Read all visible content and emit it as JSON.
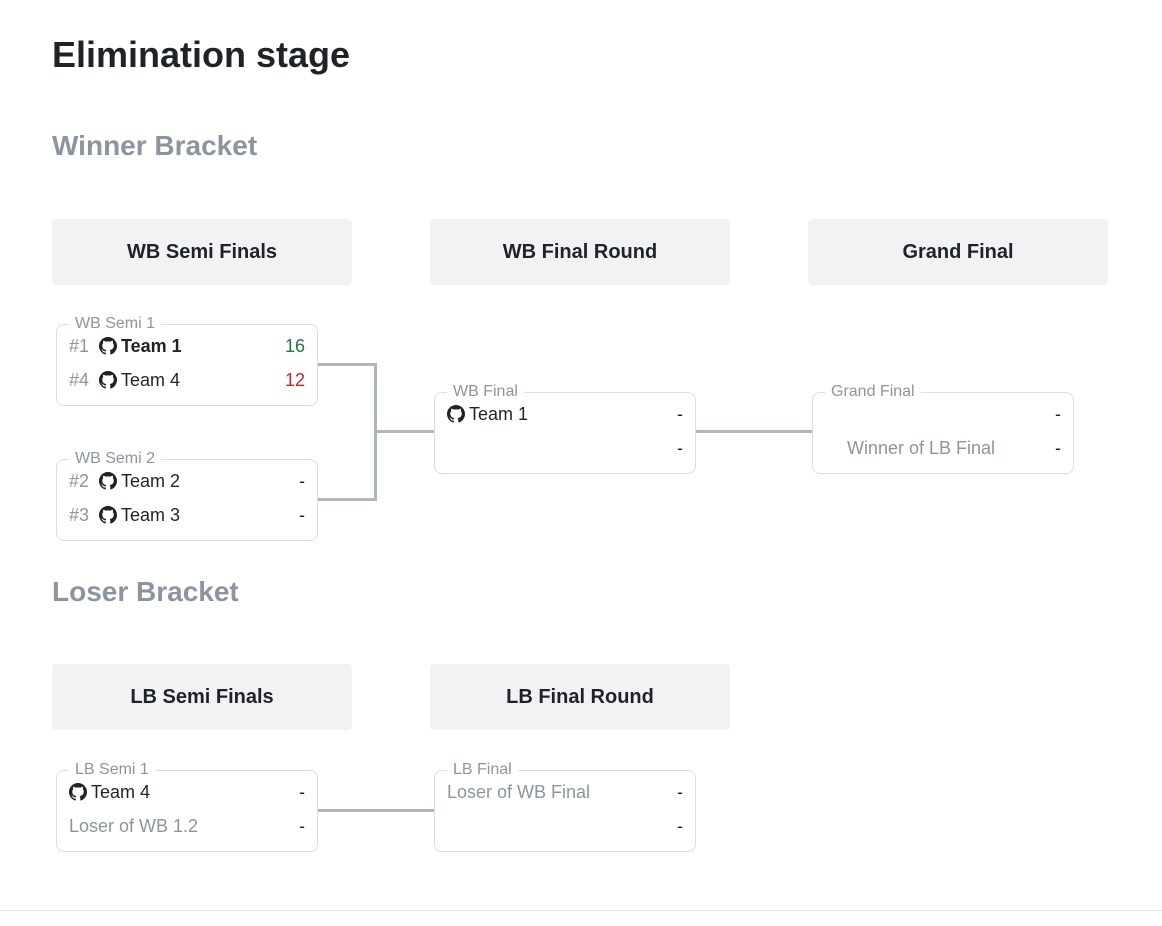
{
  "title": "Elimination stage",
  "winner_bracket": {
    "heading": "Winner Bracket",
    "rounds": {
      "semi": "WB Semi Finals",
      "final": "WB Final Round",
      "grand": "Grand Final"
    },
    "matches": {
      "semi1": {
        "label": "WB Semi 1",
        "p1": {
          "seed": "#1",
          "name": "Team 1",
          "score": "16",
          "result": "win"
        },
        "p2": {
          "seed": "#4",
          "name": "Team 4",
          "score": "12",
          "result": "lose"
        }
      },
      "semi2": {
        "label": "WB Semi 2",
        "p1": {
          "seed": "#2",
          "name": "Team 2",
          "score": "-"
        },
        "p2": {
          "seed": "#3",
          "name": "Team 3",
          "score": "-"
        }
      },
      "final": {
        "label": "WB Final",
        "p1": {
          "name": "Team 1",
          "score": "-"
        },
        "p2": {
          "name": "",
          "score": "-"
        }
      },
      "grand": {
        "label": "Grand Final",
        "p1": {
          "name": "",
          "score": "-"
        },
        "p2": {
          "name": "Winner of LB Final",
          "score": "-"
        }
      }
    }
  },
  "loser_bracket": {
    "heading": "Loser Bracket",
    "rounds": {
      "semi": "LB Semi Finals",
      "final": "LB Final Round"
    },
    "matches": {
      "semi1": {
        "label": "LB Semi 1",
        "p1": {
          "name": "Team 4",
          "score": "-"
        },
        "p2": {
          "name": "Loser of WB 1.2",
          "score": "-"
        }
      },
      "final": {
        "label": "LB Final",
        "p1": {
          "name": "Loser of WB Final",
          "score": "-"
        },
        "p2": {
          "name": "",
          "score": "-"
        }
      }
    }
  }
}
